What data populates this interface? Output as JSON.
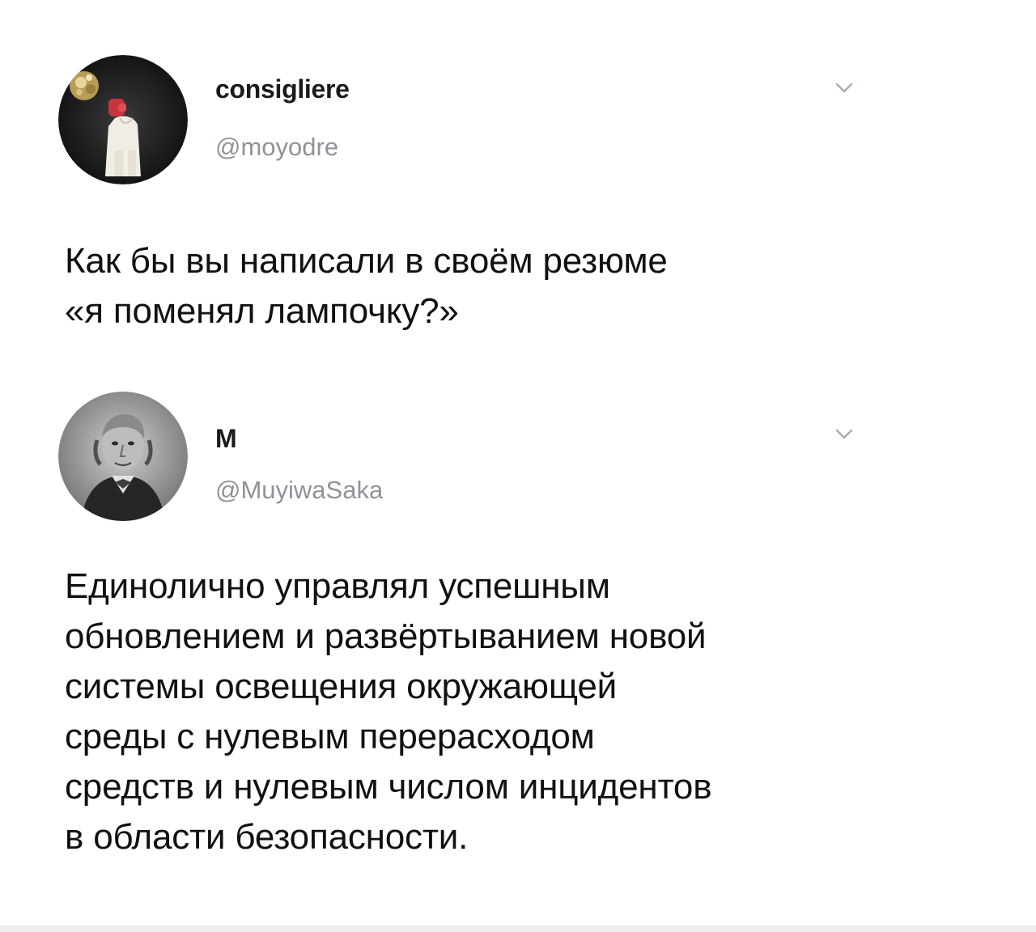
{
  "tweets": [
    {
      "display_name": "consigliere",
      "handle": "@moyodre",
      "text": "Как бы вы написали в своём резюме\n«я поменял лампочку?»"
    },
    {
      "display_name": "M",
      "handle": "@MuyiwaSaka",
      "text": "Единолично управлял успешным\nобновлением и развёртыванием новой\nсистемы освещения окружающей\nсреды с нулевым перерасходом\nсредств и нулевым числом инцидентов\nв области безопасности."
    }
  ],
  "icons": {
    "menu": "chevron-down-icon",
    "avatar_1": "avatar",
    "avatar_2": "avatar"
  },
  "colors": {
    "text": "#111111",
    "handle": "#8f9399",
    "chevron": "#a7acb3"
  }
}
